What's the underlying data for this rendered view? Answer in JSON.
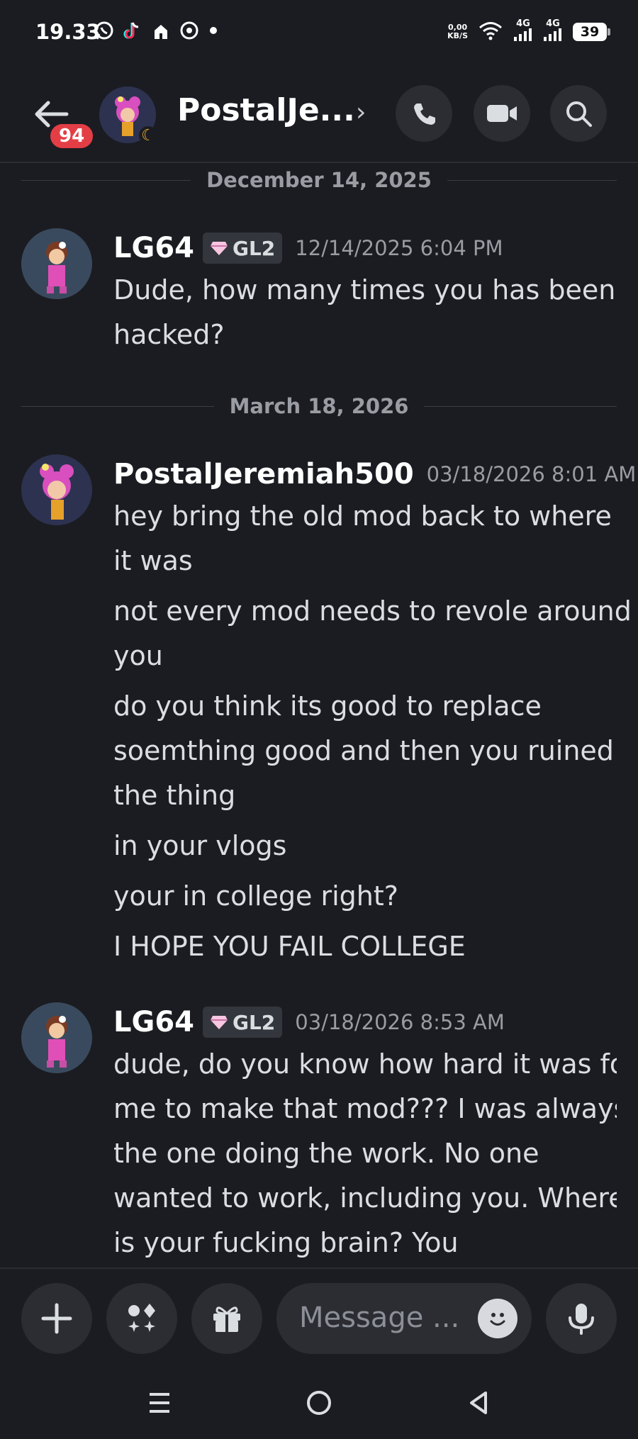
{
  "status_bar": {
    "time": "19.33",
    "net_speed_value": "0,00",
    "net_speed_unit": "KB/S",
    "signal1": "4G",
    "signal2": "4G",
    "battery": "39"
  },
  "header": {
    "badge": "94",
    "title": "PostalJe..."
  },
  "dividers": {
    "d1": "December 14, 2025",
    "d2": "March 18, 2026"
  },
  "messages": [
    {
      "author": "LG64",
      "tag": "GL2",
      "time": "12/14/2025 6:04 PM",
      "lines": [
        "Dude, how many times you has been hacked?"
      ]
    },
    {
      "author": "PostalJeremiah500",
      "time": "03/18/2026 8:01 AM",
      "lines": [
        "hey bring the old mod back to where it was",
        "not every mod needs to revole around you",
        "do you think its good to replace soemthing good and then you ruined the thing",
        "in your vlogs",
        "your in college right?",
        "I HOPE YOU FAIL COLLEGE"
      ]
    },
    {
      "author": "LG64",
      "tag": "GL2",
      "time": "03/18/2026 8:53 AM",
      "lines": [
        "dude, do you know how hard it was for me to make that mod??? I was always the one doing the work. No one wanted to work, including you. Where is your fucking brain? You"
      ]
    }
  ],
  "composer": {
    "placeholder": "Message ..."
  }
}
